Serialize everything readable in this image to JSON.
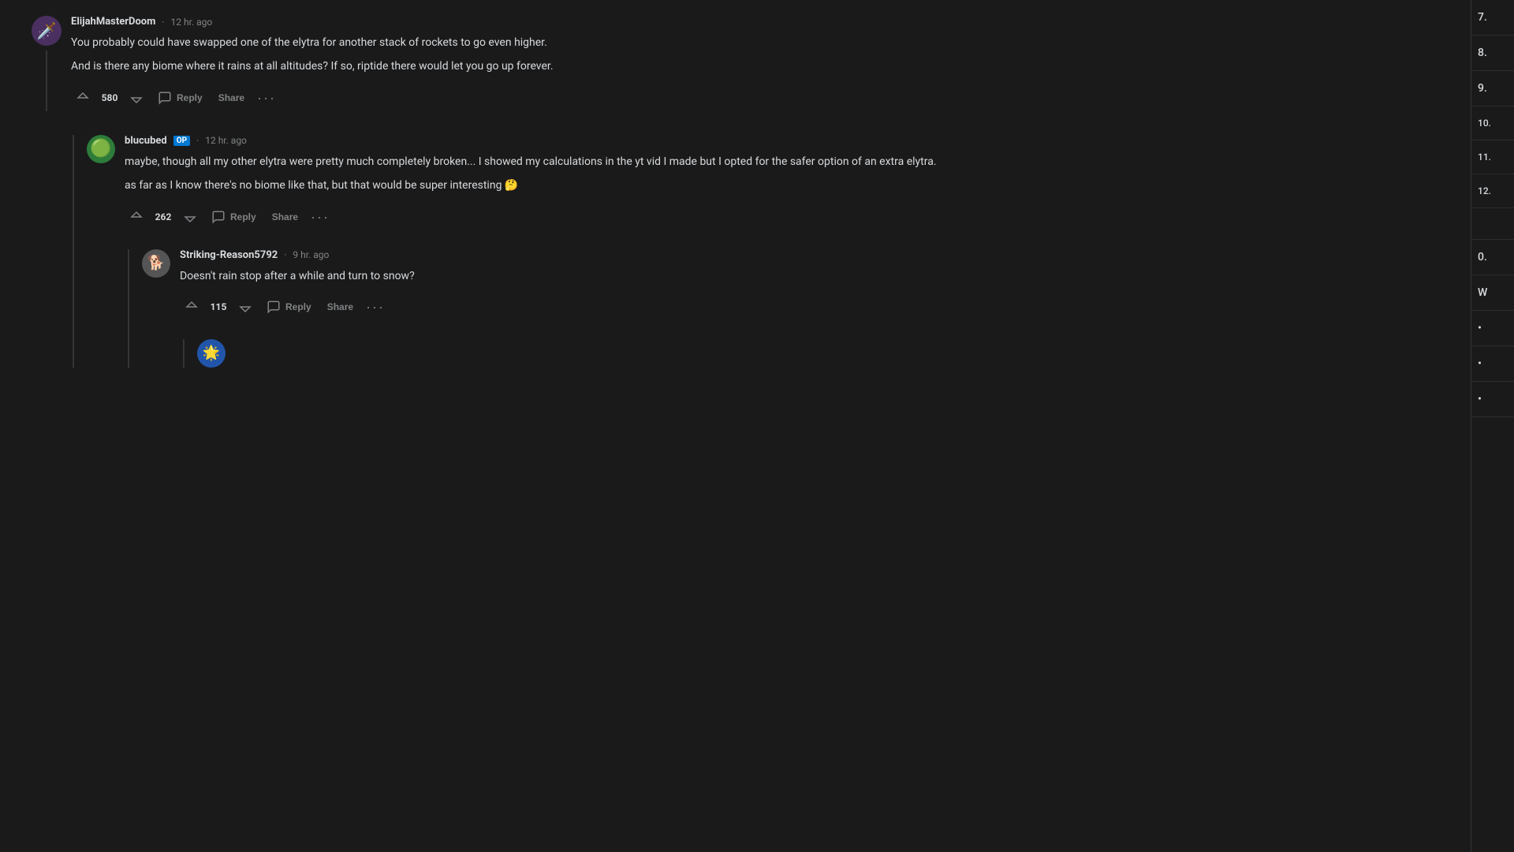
{
  "comments": [
    {
      "id": "comment1",
      "username": "ElijahMasterDoom",
      "timestamp": "12 hr. ago",
      "isOP": false,
      "avatarEmoji": "🗡️",
      "avatarBg": "#4a3060",
      "upvotes": 580,
      "text": [
        "You probably could have swapped one of the elytra for another stack of rockets to go even higher.",
        "And is there any biome where it rains at all altitudes? If so, riptide there would let you go up forever."
      ],
      "actions": {
        "reply": "Reply",
        "share": "Share"
      }
    },
    {
      "id": "comment2",
      "username": "blucubed",
      "timestamp": "12 hr. ago",
      "isOP": true,
      "avatarEmoji": "🟢",
      "avatarBg": "#2d7c3a",
      "upvotes": 262,
      "text": [
        "maybe, though all my other elytra were pretty much completely broken... I showed my calculations in the yt vid I made but I opted for the safer option of an extra elytra.",
        "as far as I know there's no biome like that, but that would be super interesting 🤔"
      ],
      "actions": {
        "reply": "Reply",
        "share": "Share"
      }
    },
    {
      "id": "comment3",
      "username": "Striking-Reason5792",
      "timestamp": "9 hr. ago",
      "isOP": false,
      "avatarEmoji": "🐕",
      "avatarBg": "#888",
      "upvotes": 115,
      "text": [
        "Doesn't rain stop after a while and turn to snow?"
      ],
      "actions": {
        "reply": "Reply",
        "share": "Share"
      }
    }
  ],
  "sidebar": {
    "numbers": [
      "7.",
      "8.",
      "9.",
      "10.",
      "11.",
      "12."
    ],
    "section1_label": "0.",
    "section1_text": "W",
    "bullets": [
      "•",
      "•",
      "•"
    ]
  },
  "actions": {
    "reply": "Reply",
    "share": "Share",
    "more": "···"
  }
}
